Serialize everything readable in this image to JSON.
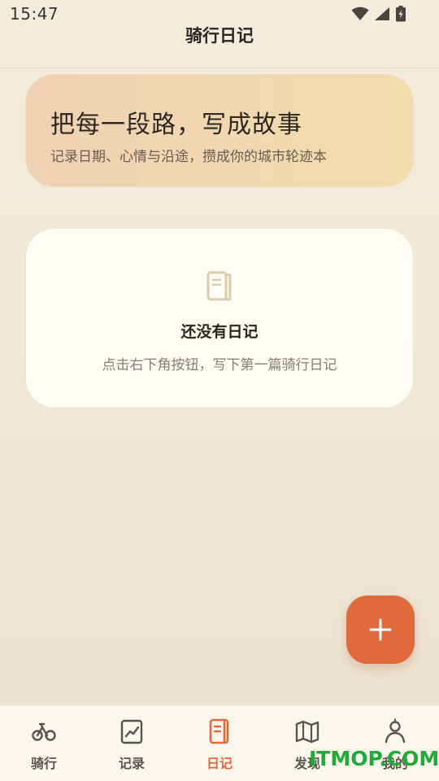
{
  "status_bar": {
    "time": "15:47",
    "icons": [
      "wifi-icon",
      "cellular-signal-icon",
      "battery-charging-icon"
    ]
  },
  "header": {
    "title": "骑行日记"
  },
  "hero": {
    "title": "把每一段路，写成故事",
    "subtitle": "记录日期、心情与沿途，攒成你的城市轮迹本"
  },
  "empty_state": {
    "icon": "notebook-icon",
    "title": "还没有日记",
    "description": "点击右下角按钮，写下第一篇骑行日记"
  },
  "fab": {
    "icon": "plus-icon"
  },
  "bottom_nav": {
    "items": [
      {
        "label": "骑行",
        "icon": "bicycle-icon",
        "active": false
      },
      {
        "label": "记录",
        "icon": "chart-icon",
        "active": false
      },
      {
        "label": "日记",
        "icon": "diary-icon",
        "active": true
      },
      {
        "label": "发现",
        "icon": "map-icon",
        "active": false
      },
      {
        "label": "我的",
        "icon": "profile-icon",
        "active": false
      }
    ]
  },
  "watermark": "ITMOP.COM",
  "colors": {
    "accent": "#e16a3c",
    "background": "#f3eadb",
    "card": "#fffcf4",
    "nav_inactive": "#5e534a"
  }
}
